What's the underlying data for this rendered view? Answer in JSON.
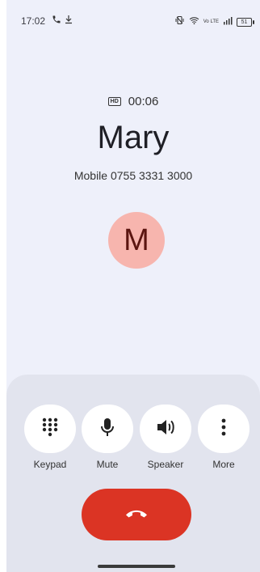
{
  "status_bar": {
    "time": "17:02",
    "battery": "51",
    "volte": "Vo LTE",
    "icons": [
      "phone-call-icon",
      "download-icon",
      "vibrate-icon",
      "wifi-icon",
      "volte-icon",
      "signal-icon",
      "battery-icon"
    ]
  },
  "call": {
    "hd_badge": "HD",
    "timer": "00:06",
    "name": "Mary",
    "number": "Mobile 0755 3331 3000",
    "avatar_letter": "M"
  },
  "controls": {
    "keypad": "Keypad",
    "mute": "Mute",
    "speaker": "Speaker",
    "more": "More"
  },
  "colors": {
    "background": "#eef0fa",
    "panel": "#e2e4ee",
    "avatar_bg": "#f7b5ae",
    "end_call": "#db3424"
  }
}
